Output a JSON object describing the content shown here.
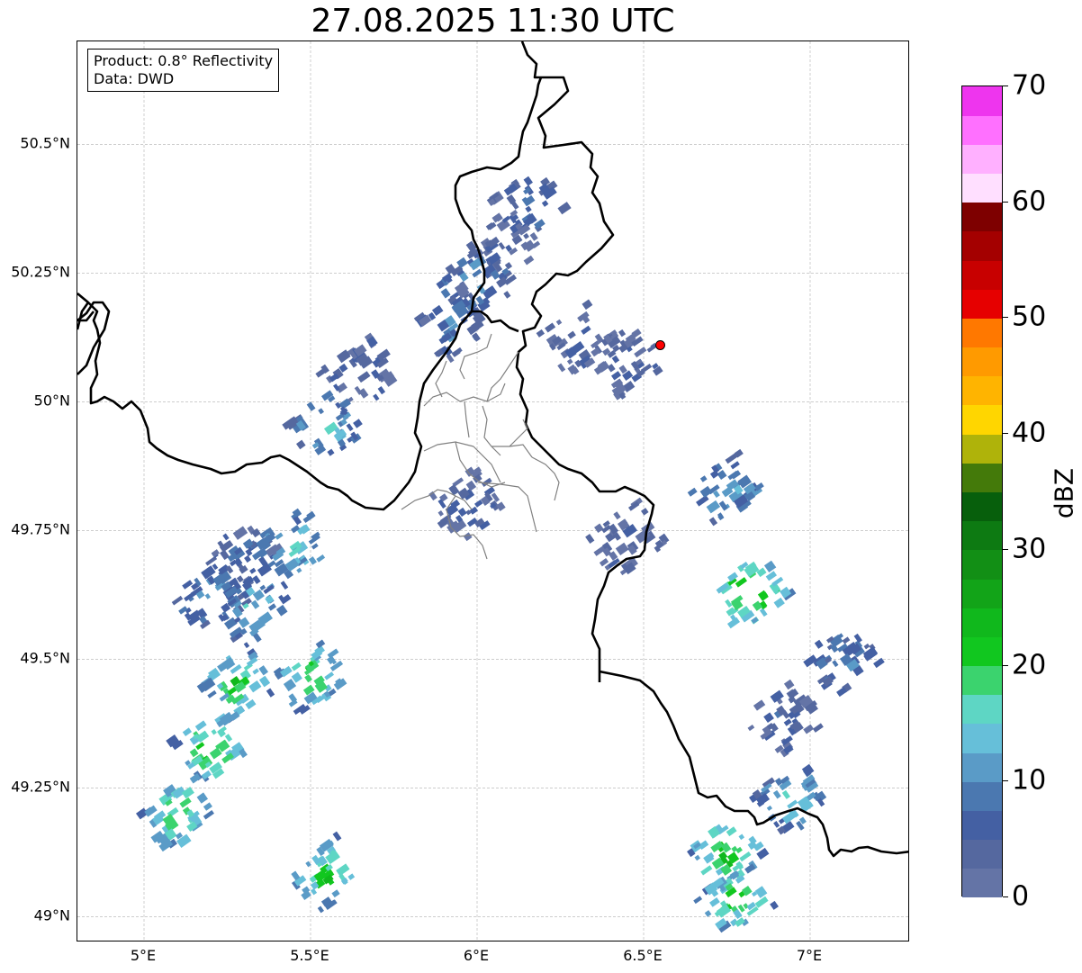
{
  "title": "27.08.2025 11:30 UTC",
  "info_box": {
    "line1": "Product: 0.8° Reflectivity",
    "line2": "Data: DWD"
  },
  "map": {
    "lon_range": [
      4.8,
      7.3
    ],
    "lat_range": [
      48.95,
      50.7
    ],
    "x_ticks": [
      {
        "value": 5.0,
        "label": "5°E"
      },
      {
        "value": 5.5,
        "label": "5.5°E"
      },
      {
        "value": 6.0,
        "label": "6°E"
      },
      {
        "value": 6.5,
        "label": "6.5°E"
      },
      {
        "value": 7.0,
        "label": "7°E"
      }
    ],
    "y_ticks": [
      {
        "value": 50.5,
        "label": "50.5°N"
      },
      {
        "value": 50.25,
        "label": "50.25°N"
      },
      {
        "value": 50.0,
        "label": "50°N"
      },
      {
        "value": 49.75,
        "label": "49.75°N"
      },
      {
        "value": 49.5,
        "label": "49.5°N"
      },
      {
        "value": 49.25,
        "label": "49.25°N"
      },
      {
        "value": 49.0,
        "label": "49°N"
      }
    ],
    "grid": true,
    "radar_site": {
      "lon": 6.55,
      "lat": 50.11,
      "color": "#ff0000"
    },
    "echo_clusters": [
      {
        "lon": 6.15,
        "lat": 50.38,
        "dbz": 8
      },
      {
        "lon": 6.08,
        "lat": 50.3,
        "dbz": 6
      },
      {
        "lon": 6.0,
        "lat": 50.23,
        "dbz": 12
      },
      {
        "lon": 5.93,
        "lat": 50.15,
        "dbz": 10
      },
      {
        "lon": 5.65,
        "lat": 50.05,
        "dbz": 6
      },
      {
        "lon": 5.55,
        "lat": 49.95,
        "dbz": 14
      },
      {
        "lon": 5.3,
        "lat": 49.7,
        "dbz": 8
      },
      {
        "lon": 5.45,
        "lat": 49.72,
        "dbz": 16
      },
      {
        "lon": 5.2,
        "lat": 49.62,
        "dbz": 12
      },
      {
        "lon": 5.33,
        "lat": 49.6,
        "dbz": 15
      },
      {
        "lon": 5.5,
        "lat": 49.47,
        "dbz": 22
      },
      {
        "lon": 5.28,
        "lat": 49.45,
        "dbz": 22
      },
      {
        "lon": 5.2,
        "lat": 49.33,
        "dbz": 24
      },
      {
        "lon": 5.1,
        "lat": 49.2,
        "dbz": 22
      },
      {
        "lon": 5.55,
        "lat": 49.08,
        "dbz": 22
      },
      {
        "lon": 6.75,
        "lat": 49.83,
        "dbz": 14
      },
      {
        "lon": 6.82,
        "lat": 49.63,
        "dbz": 28
      },
      {
        "lon": 7.1,
        "lat": 49.5,
        "dbz": 10
      },
      {
        "lon": 6.92,
        "lat": 49.38,
        "dbz": 6
      },
      {
        "lon": 6.95,
        "lat": 49.23,
        "dbz": 16
      },
      {
        "lon": 6.75,
        "lat": 49.12,
        "dbz": 24
      },
      {
        "lon": 6.78,
        "lat": 49.03,
        "dbz": 22
      },
      {
        "lon": 6.45,
        "lat": 50.08,
        "dbz": 5
      },
      {
        "lon": 6.3,
        "lat": 50.12,
        "dbz": 5
      },
      {
        "lon": 5.97,
        "lat": 49.8,
        "dbz": 6
      },
      {
        "lon": 6.45,
        "lat": 49.73,
        "dbz": 5
      }
    ]
  },
  "colorbar": {
    "label": "dBZ",
    "range": [
      0,
      70
    ],
    "ticks": [
      {
        "value": 0,
        "label": "0"
      },
      {
        "value": 10,
        "label": "10"
      },
      {
        "value": 20,
        "label": "20"
      },
      {
        "value": 30,
        "label": "30"
      },
      {
        "value": 40,
        "label": "40"
      },
      {
        "value": 50,
        "label": "50"
      },
      {
        "value": 60,
        "label": "60"
      },
      {
        "value": 70,
        "label": "70"
      }
    ],
    "colors": [
      "#6474a6",
      "#55689f",
      "#4460a3",
      "#4b78b0",
      "#5a9bc7",
      "#66bfd9",
      "#5ed6c4",
      "#3bd36e",
      "#11c71f",
      "#10b81c",
      "#12a418",
      "#128f15",
      "#0d7a12",
      "#075f0c",
      "#447a0a",
      "#afb30a",
      "#ffd600",
      "#ffb400",
      "#ff9a00",
      "#ff7800",
      "#e60000",
      "#c80000",
      "#a40000",
      "#7e0000",
      "#ffdfff",
      "#ffb0ff",
      "#ff70ff",
      "#ee35ee"
    ]
  }
}
